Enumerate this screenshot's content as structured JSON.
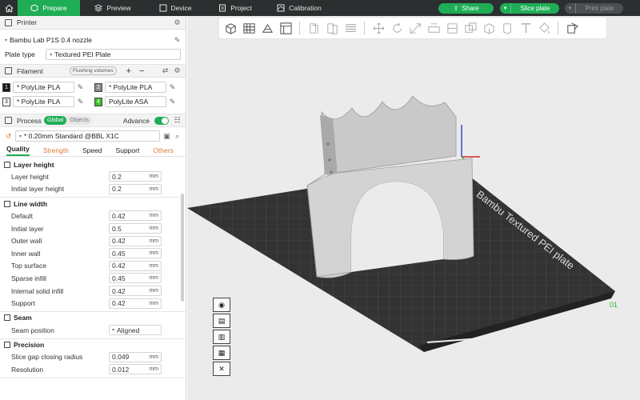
{
  "nav": {
    "tabs": [
      {
        "label": "Prepare",
        "icon": "prepare-icon",
        "active": true
      },
      {
        "label": "Preview",
        "icon": "preview-icon"
      },
      {
        "label": "Device",
        "icon": "device-icon"
      },
      {
        "label": "Project",
        "icon": "project-icon"
      },
      {
        "label": "Calibration",
        "icon": "calibration-icon"
      }
    ],
    "share_label": "Share",
    "slice_label": "Slice plate",
    "print_label": "Print plate"
  },
  "printer": {
    "section_title": "Printer",
    "name": "Bambu Lab P1S 0.4 nozzle",
    "plate_type_label": "Plate type",
    "plate_type_value": "Textured PEI Plate"
  },
  "filament": {
    "section_title": "Filament",
    "flushing_label": "Flushing volumes",
    "items": [
      {
        "num": "1",
        "name": "* PolyLite PLA",
        "color": "#1a1a1a",
        "text": "#ffffff"
      },
      {
        "num": "2",
        "name": "* PolyLite PLA",
        "color": "#8a8a8a",
        "text": "#ffffff"
      },
      {
        "num": "3",
        "name": "* PolyLite PLA",
        "color": "#ffffff",
        "text": "#222222"
      },
      {
        "num": "4",
        "name": "PolyLite ASA",
        "color": "#3fbf2a",
        "text": "#ffffff"
      }
    ]
  },
  "process": {
    "section_title": "Process",
    "global_label": "Global",
    "objects_label": "Objects",
    "advance_label": "Advance",
    "preset": "* 0.20mm Standard @BBL X1C",
    "tabs": [
      "Quality",
      "Strength",
      "Speed",
      "Support",
      "Others"
    ],
    "groups": [
      {
        "title": "Layer height",
        "params": [
          {
            "label": "Layer height",
            "value": "0.2",
            "unit": "mm"
          },
          {
            "label": "Initial layer height",
            "value": "0.2",
            "unit": "mm"
          }
        ]
      },
      {
        "title": "Line width",
        "params": [
          {
            "label": "Default",
            "value": "0.42",
            "unit": "mm"
          },
          {
            "label": "Initial layer",
            "value": "0.5",
            "unit": "mm"
          },
          {
            "label": "Outer wall",
            "value": "0.42",
            "unit": "mm"
          },
          {
            "label": "Inner wall",
            "value": "0.45",
            "unit": "mm"
          },
          {
            "label": "Top surface",
            "value": "0.42",
            "unit": "mm"
          },
          {
            "label": "Sparse infill",
            "value": "0.45",
            "unit": "mm"
          },
          {
            "label": "Internal solid infill",
            "value": "0.42",
            "unit": "mm"
          },
          {
            "label": "Support",
            "value": "0.42",
            "unit": "mm"
          }
        ]
      },
      {
        "title": "Seam",
        "params": [
          {
            "label": "Seam position",
            "value": "Aligned",
            "unit": ""
          }
        ]
      },
      {
        "title": "Precision",
        "params": [
          {
            "label": "Slice gap closing radius",
            "value": "0.049",
            "unit": "mm"
          },
          {
            "label": "Resolution",
            "value": "0.012",
            "unit": "mm"
          }
        ]
      }
    ]
  },
  "viewport": {
    "plate_text": "Bambu Textured PEI plate",
    "plate_number": "01"
  }
}
